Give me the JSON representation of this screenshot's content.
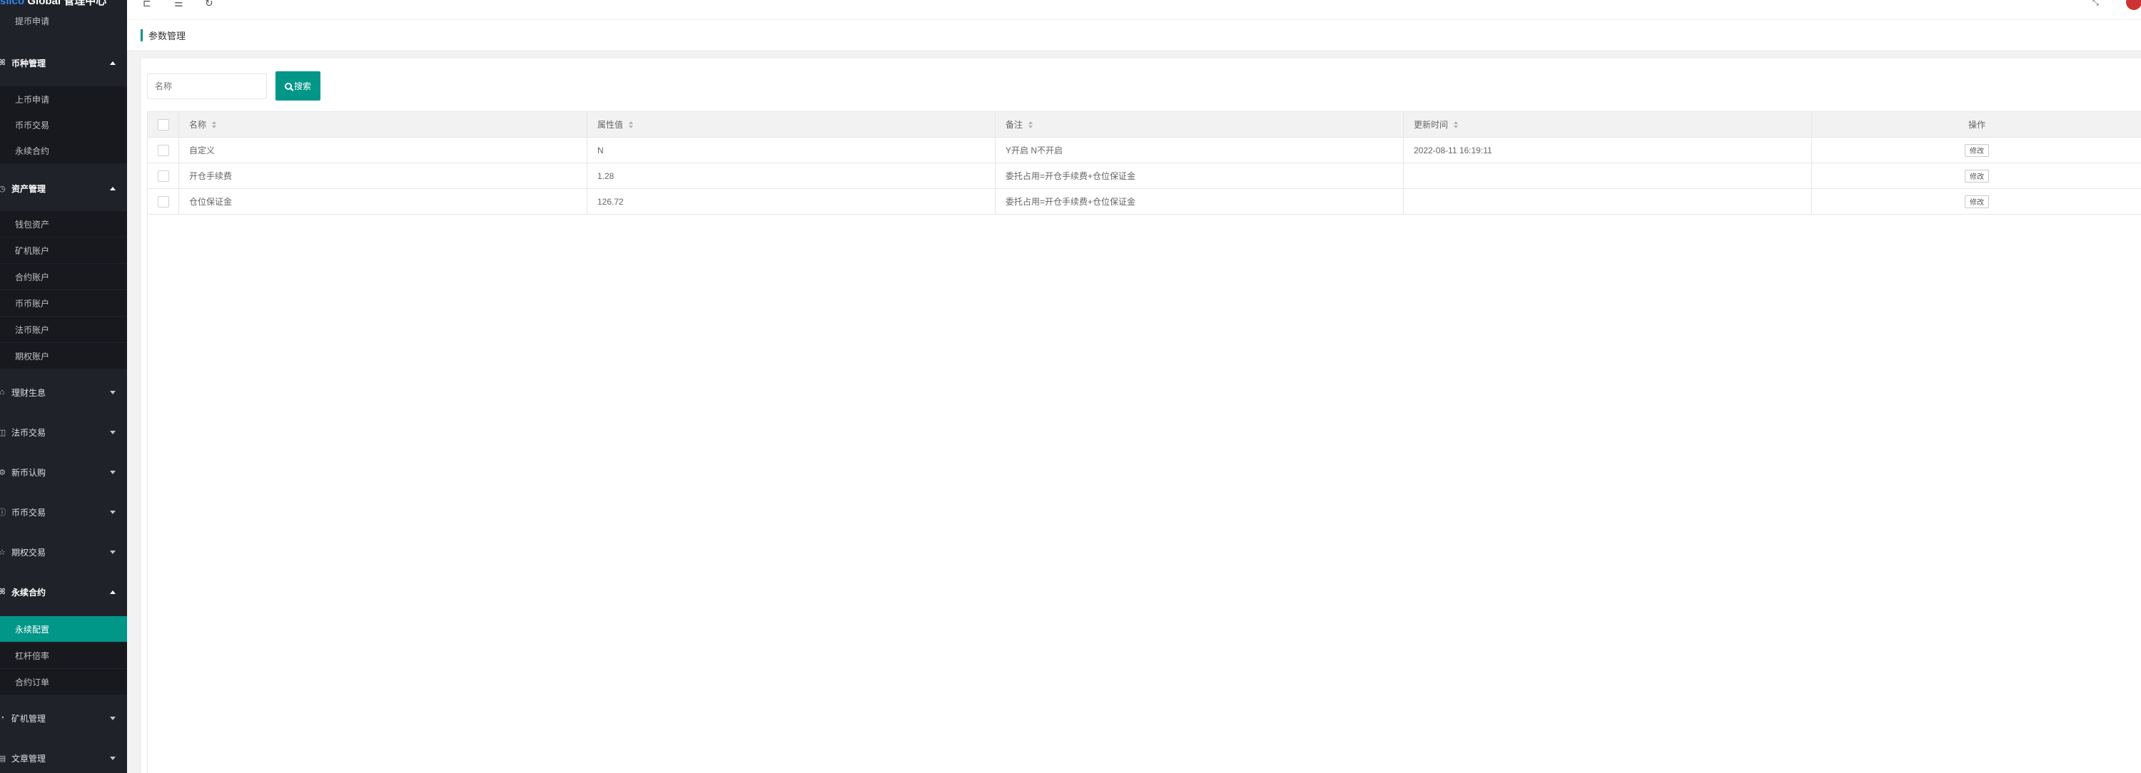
{
  "app": {
    "title_prefix": "slico",
    "title_main": " Global 管理中心"
  },
  "sidebar": {
    "top_item": "提币申请",
    "groups": [
      {
        "label": "币种管理",
        "icon": "user-icon",
        "open": true,
        "items": [
          "上币申请",
          "币币交易",
          "永续合约"
        ]
      },
      {
        "label": "资产管理",
        "icon": "clock-icon",
        "open": true,
        "items": [
          "钱包资产",
          "矿机账户",
          "合约账户",
          "币币账户",
          "法币账户",
          "期权账户"
        ]
      },
      {
        "label": "理财生息",
        "icon": "home-icon",
        "open": false
      },
      {
        "label": "法币交易",
        "icon": "lock-icon",
        "open": false
      },
      {
        "label": "新币认购",
        "icon": "settings-icon",
        "open": false
      },
      {
        "label": "币币交易",
        "icon": "info-icon",
        "open": false
      },
      {
        "label": "期权交易",
        "icon": "star-icon",
        "open": false
      },
      {
        "label": "永续合约",
        "icon": "user-icon",
        "open": true,
        "items": [
          "永续配置",
          "杠杆倍率",
          "合约订单"
        ],
        "active_item": "永续配置"
      },
      {
        "label": "矿机管理",
        "icon": "chart-icon",
        "open": false
      },
      {
        "label": "文章管理",
        "icon": "document-icon",
        "open": false
      }
    ]
  },
  "topbar": {
    "icons": [
      "shrink-icon",
      "refresh-list-icon",
      "reload-icon",
      "fullscreen-icon"
    ]
  },
  "breadcrumb": {
    "title": "参数管理"
  },
  "search": {
    "placeholder": "名称",
    "button_label": "搜索"
  },
  "table": {
    "columns": [
      "名称",
      "属性值",
      "备注",
      "更新时间",
      "操作"
    ],
    "rows": [
      {
        "name": "自定义",
        "value": "N",
        "remark": "Y开启 N不开启",
        "updated": "2022-08-11 16:19:11",
        "action": "修改"
      },
      {
        "name": "开仓手续费",
        "value": "1.28",
        "remark": "委托占用=开仓手续费+仓位保证金",
        "updated": "",
        "action": "修改"
      },
      {
        "name": "仓位保证金",
        "value": "126.72",
        "remark": "委托占用=开仓手续费+仓位保证金",
        "updated": "",
        "action": "修改"
      }
    ]
  },
  "colors": {
    "accent": "#009688",
    "sidebar_bg": "#20222a",
    "avatar": "#cc3333"
  }
}
